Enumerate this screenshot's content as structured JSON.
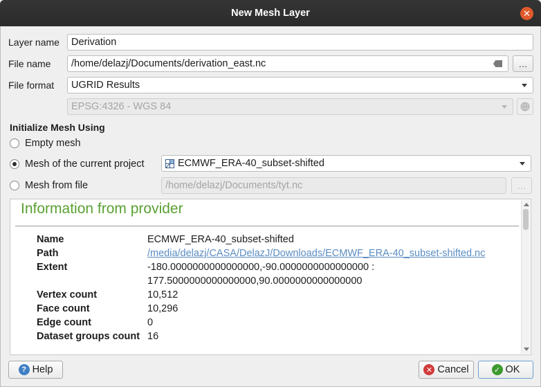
{
  "window": {
    "title": "New Mesh Layer"
  },
  "layer_name": {
    "label": "Layer name",
    "value": "Derivation"
  },
  "file_name": {
    "label": "File name",
    "value": "/home/delazj/Documents/derivation_east.nc",
    "browse": "…"
  },
  "file_format": {
    "label": "File format",
    "value": "UGRID Results"
  },
  "crs": {
    "value": "EPSG:4326 - WGS 84"
  },
  "init": {
    "title": "Initialize Mesh Using",
    "empty_mesh": "Empty mesh",
    "current_project": "Mesh of the current project",
    "current_project_value": "ECMWF_ERA-40_subset-shifted",
    "from_file": "Mesh from file",
    "from_file_value": "/home/delazj/Documents/tyt.nc",
    "from_file_browse": "…",
    "selected": "current_project"
  },
  "info": {
    "title": "Information from provider",
    "rows": [
      {
        "key": "Name",
        "value": "ECMWF_ERA-40_subset-shifted"
      },
      {
        "key": "Path",
        "value": "/media/delazj/CASA/DelazJ/Downloads/ECMWF_ERA-40_subset-shifted.nc"
      },
      {
        "key": "Extent",
        "value": "-180.0000000000000000,-90.0000000000000000 : 177.5000000000000000,90.0000000000000000"
      },
      {
        "key": "Vertex count",
        "value": "10,512"
      },
      {
        "key": "Face count",
        "value": "10,296"
      },
      {
        "key": "Edge count",
        "value": "0"
      },
      {
        "key": "Dataset groups count",
        "value": "16"
      }
    ]
  },
  "buttons": {
    "help": "Help",
    "cancel": "Cancel",
    "ok": "OK"
  },
  "colors": {
    "info_title": "#5aa032",
    "link": "#5b8cc2",
    "close": "#e05a2c",
    "help_icon": "#3f7fc4",
    "cancel_icon": "#d23b3b",
    "ok_icon": "#3d9a2f"
  }
}
